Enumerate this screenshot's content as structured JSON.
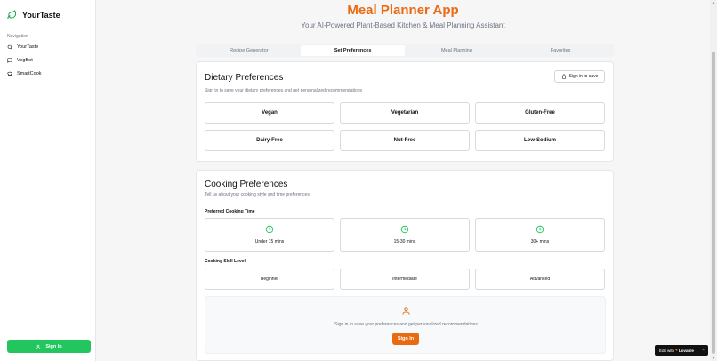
{
  "sidebar": {
    "brand": "YourTaste",
    "nav_title": "Navigation",
    "items": [
      {
        "label": "YourTaste",
        "icon": "search-icon"
      },
      {
        "label": "VegBot",
        "icon": "chat-icon"
      },
      {
        "label": "SmartCook",
        "icon": "chef-hat-icon"
      }
    ],
    "signin_label": "Sign In"
  },
  "header": {
    "title": "Meal Planner App",
    "subtitle": "Your AI-Powered Plant-Based Kitchen & Meal Planning Assistant"
  },
  "tabs": [
    {
      "label": "Recipe Generator",
      "active": false
    },
    {
      "label": "Set Preferences",
      "active": true
    },
    {
      "label": "Meal Planning",
      "active": false
    },
    {
      "label": "Favorites",
      "active": false
    }
  ],
  "dietary": {
    "title": "Dietary Preferences",
    "subtitle": "Sign in to save your dietary preferences and get personalized recommendations",
    "save_label": "Sign in to save",
    "options": [
      "Vegan",
      "Vegetarian",
      "Gluten-Free",
      "Dairy-Free",
      "Nut-Free",
      "Low-Sodium"
    ]
  },
  "cooking": {
    "title": "Cooking Preferences",
    "subtitle": "Tell us about your cooking style and time preferences",
    "time_label": "Preferred Cooking Time",
    "time_options": [
      "Under 15 mins",
      "15-30 mins",
      "30+ mins"
    ],
    "skill_label": "Cooking Skill Level",
    "skill_options": [
      "Beginner",
      "Intermediate",
      "Advanced"
    ],
    "signin_message": "Sign in to save your preferences and get personalized recommendations",
    "signin_button": "Sign In"
  },
  "badge": {
    "prefix": "Edit with",
    "brand": "Lovable",
    "close": "×"
  },
  "colors": {
    "accent_orange": "#ea6a12",
    "accent_green": "#22c55e"
  }
}
